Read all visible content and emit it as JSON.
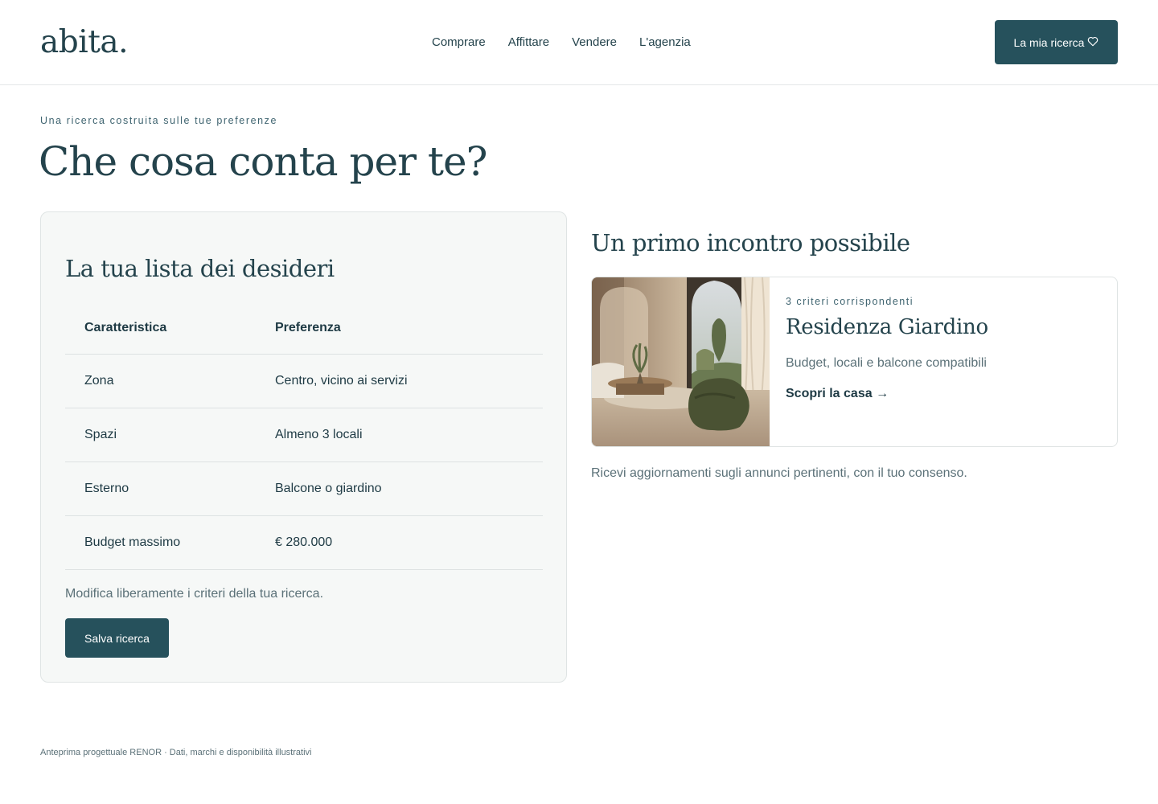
{
  "header": {
    "logo": "abita.",
    "nav": [
      "Comprare",
      "Affittare",
      "Vendere",
      "L'agenzia"
    ],
    "cta_label": "La mia ricerca",
    "cta_icon": "heart-icon"
  },
  "intro": {
    "eyebrow": "Una ricerca costruita sulle tue preferenze",
    "title": "Che cosa conta per te?"
  },
  "wishlist": {
    "title": "La tua lista dei desideri",
    "columns": [
      "Caratteristica",
      "Preferenza"
    ],
    "rows": [
      {
        "feature": "Zona",
        "preference": "Centro, vicino ai servizi"
      },
      {
        "feature": "Spazi",
        "preference": "Almeno 3 locali"
      },
      {
        "feature": "Esterno",
        "preference": "Balcone o giardino"
      },
      {
        "feature": "Budget massimo",
        "preference": "€ 280.000"
      }
    ],
    "note": "Modifica liberamente i criteri della tua ricerca.",
    "save_label": "Salva ricerca"
  },
  "match": {
    "title": "Un primo incontro possibile",
    "listing": {
      "criteria": "3 criteri corrispondenti",
      "name": "Residenza Giardino",
      "description": "Budget, locali e balcone compatibili",
      "link_label": "Scopri la casa →"
    },
    "consent": "Ricevi aggiornamenti sugli annunci pertinenti, con il tuo consenso."
  },
  "footer": {
    "text": "Anteprima progettuale RENOR · Dati, marchi e disponibilità illustrativi"
  },
  "colors": {
    "primary": "#26515c",
    "text": "#24434c",
    "muted": "#5b7178",
    "card_bg": "#f6f8f7",
    "border": "#dfe4e4"
  }
}
